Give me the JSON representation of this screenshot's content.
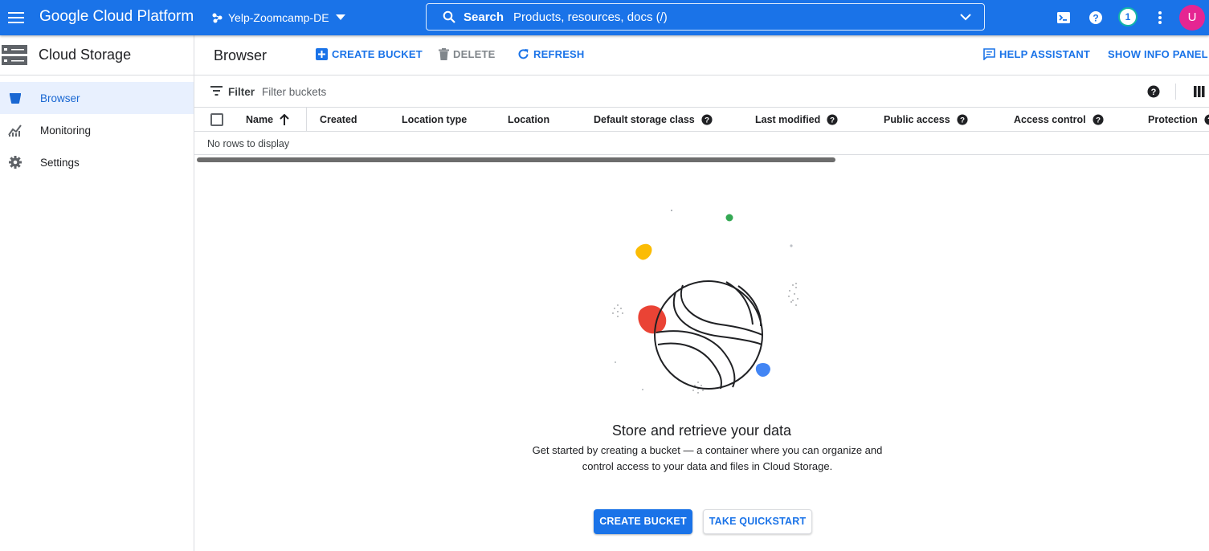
{
  "topbar": {
    "brand": "Google Cloud Platform",
    "project": "Yelp-Zoomcamp-DE",
    "search_label": "Search",
    "search_placeholder": "Products, resources, docs (/)",
    "notifications_count": "1",
    "avatar_initial": "U",
    "color": "#1a73e8"
  },
  "sidebar": {
    "product_title": "Cloud Storage",
    "items": [
      {
        "label": "Browser",
        "icon": "bucket-icon",
        "active": true
      },
      {
        "label": "Monitoring",
        "icon": "chart-icon",
        "active": false
      },
      {
        "label": "Settings",
        "icon": "gear-icon",
        "active": false
      }
    ]
  },
  "toolbar": {
    "title": "Browser",
    "create_bucket": "CREATE BUCKET",
    "delete": "DELETE",
    "refresh": "REFRESH",
    "help_assistant": "HELP ASSISTANT",
    "show_info_panel": "SHOW INFO PANEL"
  },
  "filter": {
    "label": "Filter",
    "placeholder": "Filter buckets"
  },
  "table": {
    "columns": [
      "Name",
      "Created",
      "Location type",
      "Location",
      "Default storage class",
      "Last modified",
      "Public access",
      "Access control",
      "Protection"
    ],
    "empty_text": "No rows to display"
  },
  "empty_state": {
    "title": "Store and retrieve your data",
    "description": "Get started by creating a bucket — a container where you can organize and control access to your data and files in Cloud Storage.",
    "primary_button": "CREATE BUCKET",
    "secondary_button": "TAKE QUICKSTART"
  }
}
